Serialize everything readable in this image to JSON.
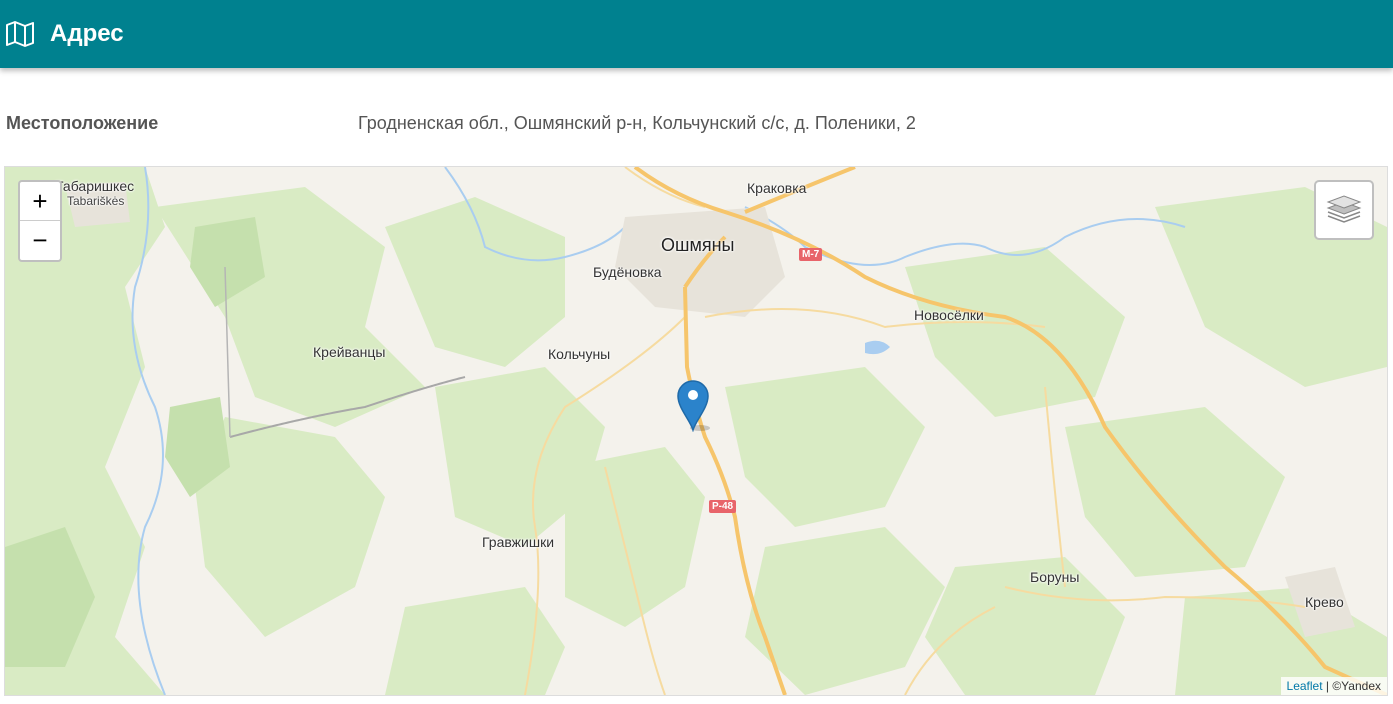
{
  "header": {
    "title": "Адрес",
    "icon": "map-icon"
  },
  "location": {
    "label": "Местоположение",
    "value": "Гродненская обл., Ошмянский р-н, Кольчунский с/с, д. Поленики, 2"
  },
  "map": {
    "places": {
      "tabariskes": "Табаришкес",
      "tabariskes_lt": "Tabariškės",
      "krakovka": "Краковка",
      "oshmyany": "Ошмяны",
      "budenovka": "Будёновка",
      "novoselki": "Новосёлки",
      "kreivantsy": "Крейванцы",
      "kolchuny": "Кольчуны",
      "gravzhishki": "Гравжишки",
      "boruny": "Боруны",
      "krevo": "Крево"
    },
    "roads": {
      "m7": "М-7",
      "r48": "Р-48"
    },
    "zoom_in": "+",
    "zoom_out": "−",
    "layers_icon": "layers-icon",
    "marker_icon": "map-marker-icon",
    "attribution": {
      "leaflet": "Leaflet",
      "separator": " | ",
      "provider": "©Yandex"
    }
  }
}
